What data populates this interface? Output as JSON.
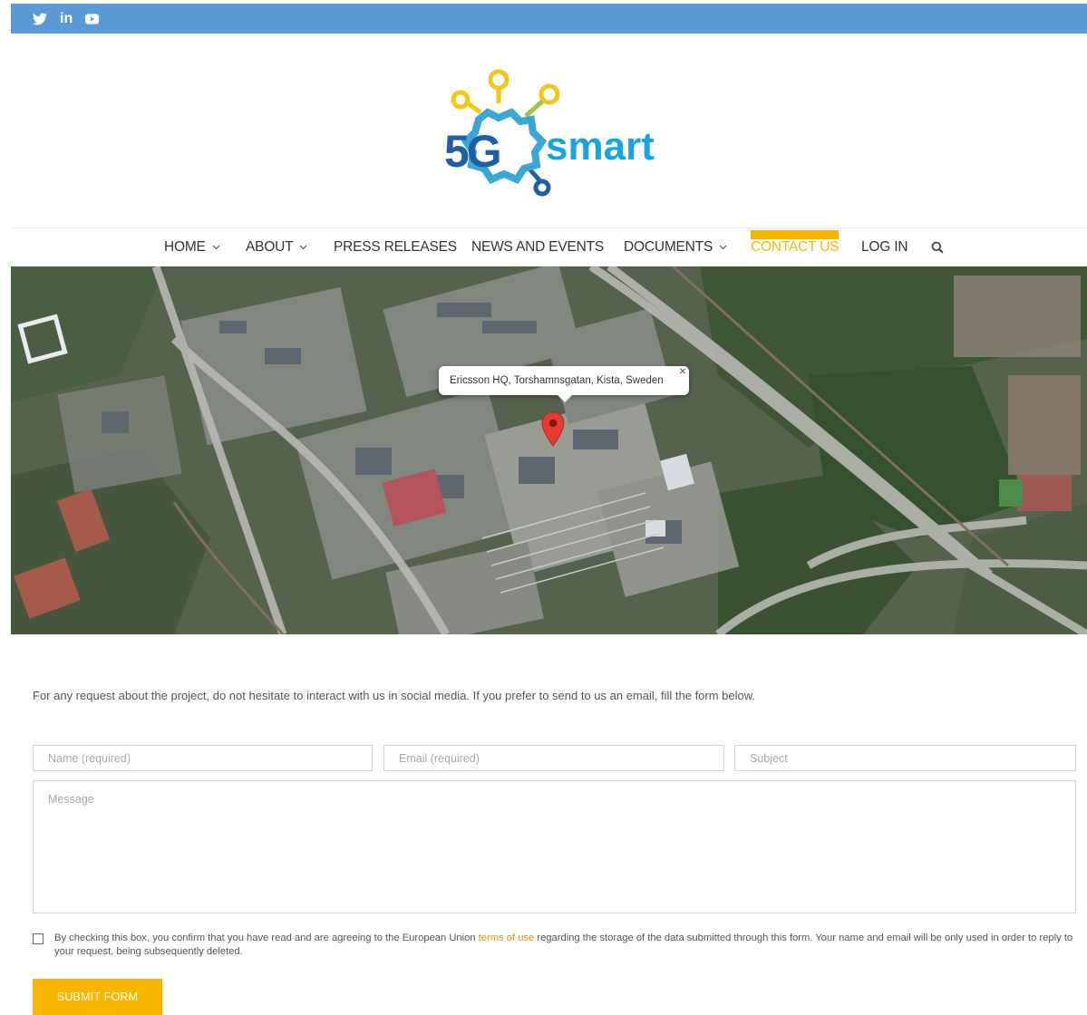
{
  "social": {
    "icons": [
      "twitter-icon",
      "linkedin-icon",
      "youtube-icon"
    ],
    "linkedin_text": "in"
  },
  "logo": {
    "mark": "5G",
    "word": "smart",
    "colors": {
      "yellow": "#f5c518",
      "blue": "#1aa3e0",
      "green": "#7dc242",
      "navy": "#1f5fa8"
    }
  },
  "nav": {
    "items": [
      {
        "label": "HOME",
        "dropdown": true
      },
      {
        "label": "ABOUT",
        "dropdown": true
      },
      {
        "label": "PRESS RELEASES",
        "dropdown": false
      },
      {
        "label": "NEWS AND EVENTS",
        "dropdown": false
      },
      {
        "label": "DOCUMENTS",
        "dropdown": true
      },
      {
        "label": "CONTACT US",
        "dropdown": false,
        "active": true
      },
      {
        "label": "LOG IN",
        "dropdown": false
      }
    ],
    "search_icon": "search-icon",
    "active_color": "#f7b500"
  },
  "map": {
    "info_window_text": "Ericsson HQ, Torshamnsgatan, Kista, Sweden",
    "close_glyph": "×",
    "pin_icon": "map-pin-icon"
  },
  "contact": {
    "intro": "For any request about the project, do not hesitate to interact with us in social media. If you prefer to send to us an email, fill the form below.",
    "name_placeholder": "Name (required)",
    "email_placeholder": "Email (required)",
    "subject_placeholder": "Subject",
    "message_placeholder": "Message",
    "consent_before": "By checking this box, you confirm that you have read and are agreeing to the European Union ",
    "consent_link": "terms of use",
    "consent_after": " regarding the storage of the data submitted through this form. Your name and email will be only used in order to reply to your request, being subsequently deleted.",
    "submit_label": "SUBMIT FORM"
  },
  "colors": {
    "topbar": "#5b9bd5",
    "accent": "#f7b500",
    "link": "#e08e0b"
  }
}
